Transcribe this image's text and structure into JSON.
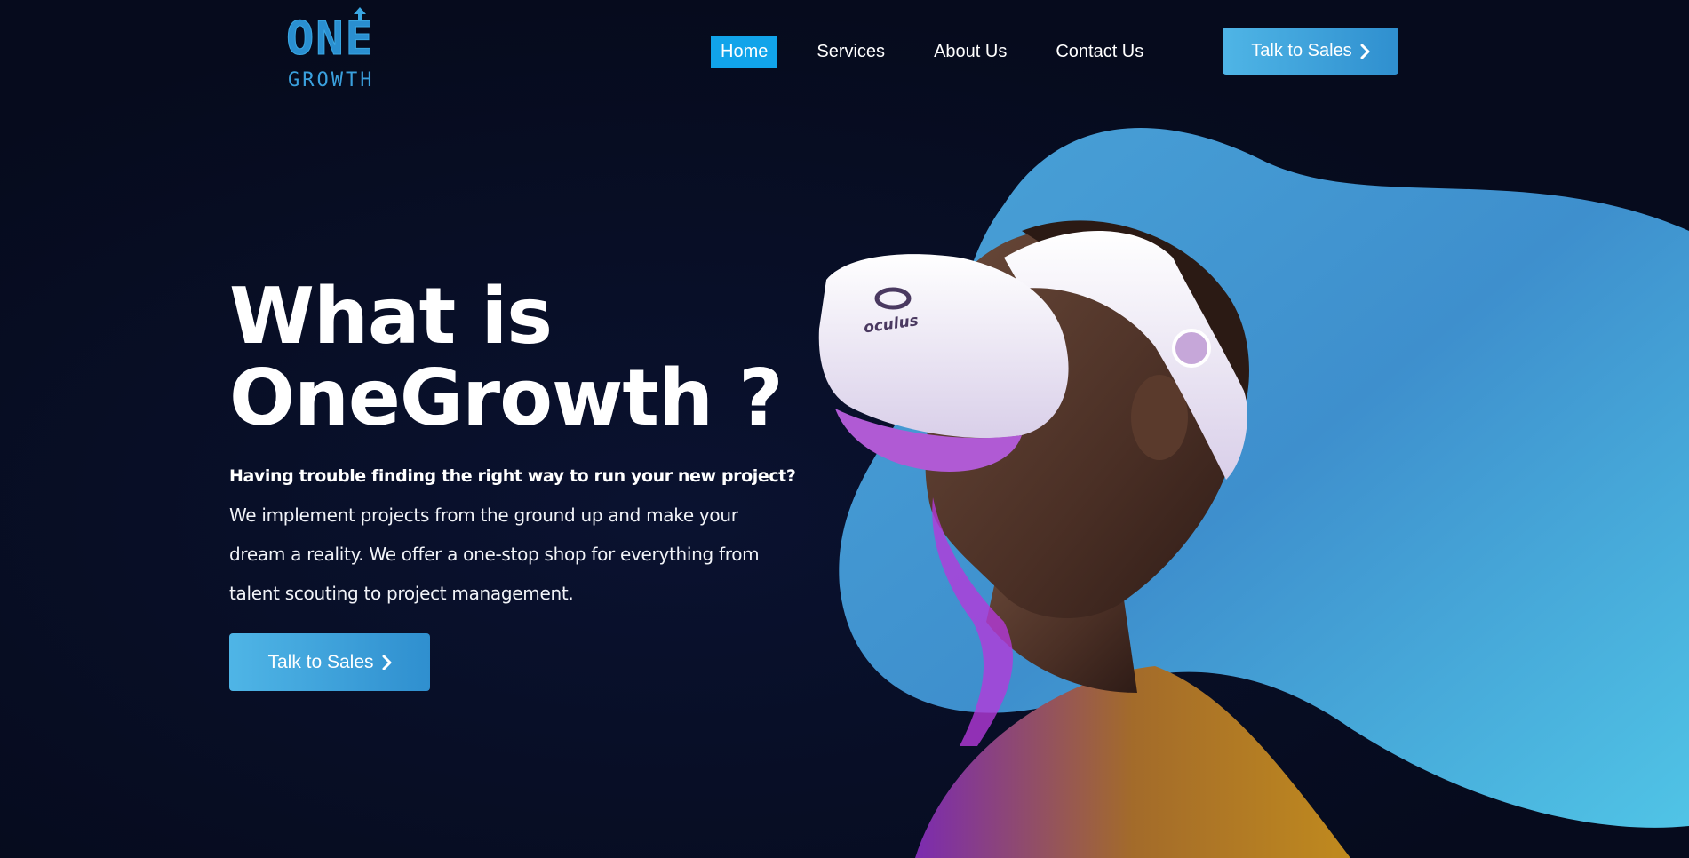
{
  "brand": {
    "logo_top": "ONE",
    "logo_bottom": "GROWTH",
    "accent": "#2a8fd0"
  },
  "nav": {
    "items": [
      {
        "label": "Home",
        "active": true
      },
      {
        "label": "Services",
        "active": false
      },
      {
        "label": "About Us",
        "active": false
      },
      {
        "label": "Contact Us",
        "active": false
      }
    ],
    "cta_label": "Talk to Sales",
    "active_color": "#11a4ea"
  },
  "hero": {
    "title_line1": "What is",
    "title_line2": "OneGrowth ?",
    "lead": "Having trouble finding the right way to run your new project?",
    "body": "We implement projects from the ground up and make your dream a reality. We offer a one-stop shop for everything from talent scouting to project management.",
    "cta_label": "Talk to Sales",
    "blob_colors": [
      "#3f8fce",
      "#4fc3e8"
    ],
    "headset_brand": "oculus",
    "icons": {
      "chevron": "chevron-right-icon",
      "arrow": "arrow-up-icon"
    }
  }
}
